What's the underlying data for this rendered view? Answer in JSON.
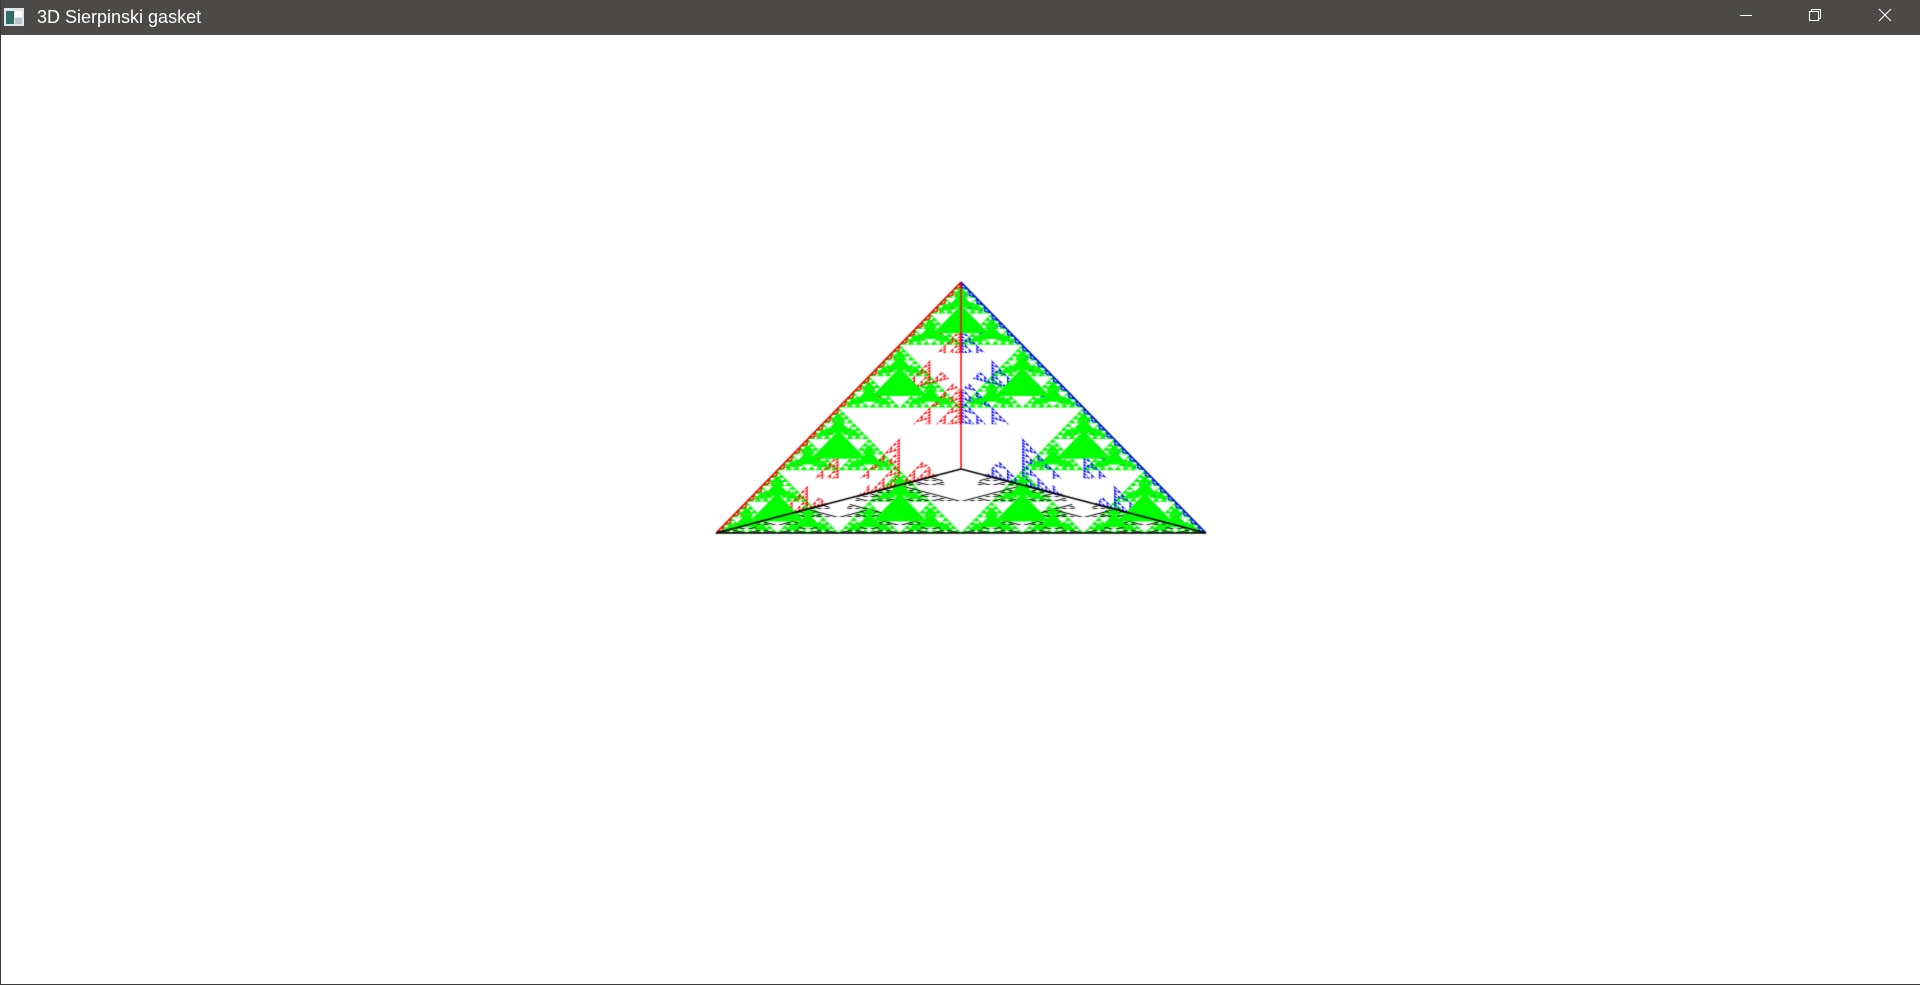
{
  "window": {
    "title": "3D Sierpinski gasket",
    "app_icon": "app-window-icon",
    "controls": {
      "minimize_icon": "minimize-icon",
      "restore_icon": "restore-icon",
      "close_icon": "close-icon"
    }
  },
  "scene": {
    "subject": "sierpinski-tetrahedron",
    "background_color": "#ffffff",
    "face_colors": {
      "left": "#ff0000",
      "right": "#0000ff",
      "base": "#000000",
      "filled_triangles": "#00ff00"
    }
  }
}
